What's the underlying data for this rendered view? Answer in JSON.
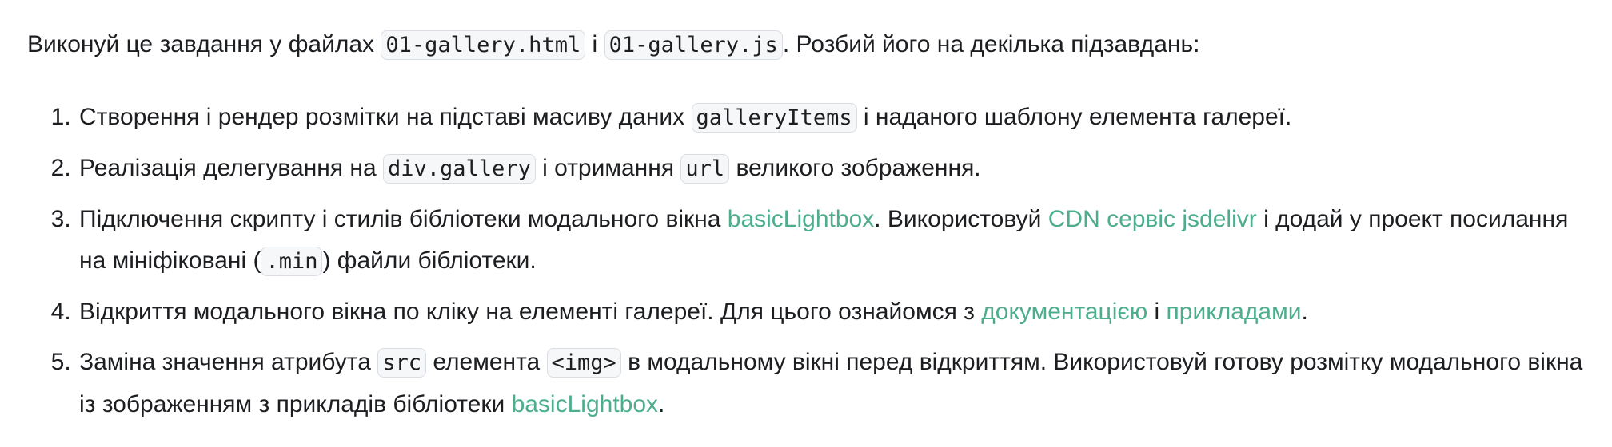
{
  "intro": {
    "t1": "Виконуй це завдання у файлах ",
    "file_html": "01-gallery.html",
    "t2": " і ",
    "file_js": "01-gallery.js",
    "t3": ". Розбий його на декілька підзавдань:"
  },
  "steps": [
    {
      "t1": "Створення і рендер розмітки на підставі масиву даних ",
      "code1": "galleryItems",
      "t2": " і наданого шаблону елемента галереї."
    },
    {
      "t1": "Реалізація делегування на ",
      "code1": "div.gallery",
      "t2": " і отримання ",
      "code2": "url",
      "t3": " великого зображення."
    },
    {
      "t1": "Підключення скрипту і стилів бібліотеки модального вікна ",
      "link1": "basicLightbox",
      "t2": ". Використовуй ",
      "link2": "CDN сервіс jsdelivr",
      "t3": " і додай у проект посилання на мініфіковані (",
      "code1": ".min",
      "t4": ") файли бібліотеки."
    },
    {
      "t1": "Відкриття модального вікна по кліку на елементі галереї. Для цього ознайомся з ",
      "link1": "документацією",
      "t2": " і ",
      "link2": "прикладами",
      "t3": "."
    },
    {
      "t1": "Заміна значення атрибута ",
      "code1": "src",
      "t2": " елемента ",
      "code2": "<img>",
      "t3": " в модальному вікні перед відкриттям. Використовуй готову розмітку модального вікна із зображенням з прикладів бібліотеки ",
      "link1": "basicLightbox",
      "t4": "."
    }
  ],
  "colors": {
    "text": "#1c1e21",
    "link": "#4dae8c",
    "code_bg": "#f6f7f8",
    "code_border": "#dadde1"
  }
}
